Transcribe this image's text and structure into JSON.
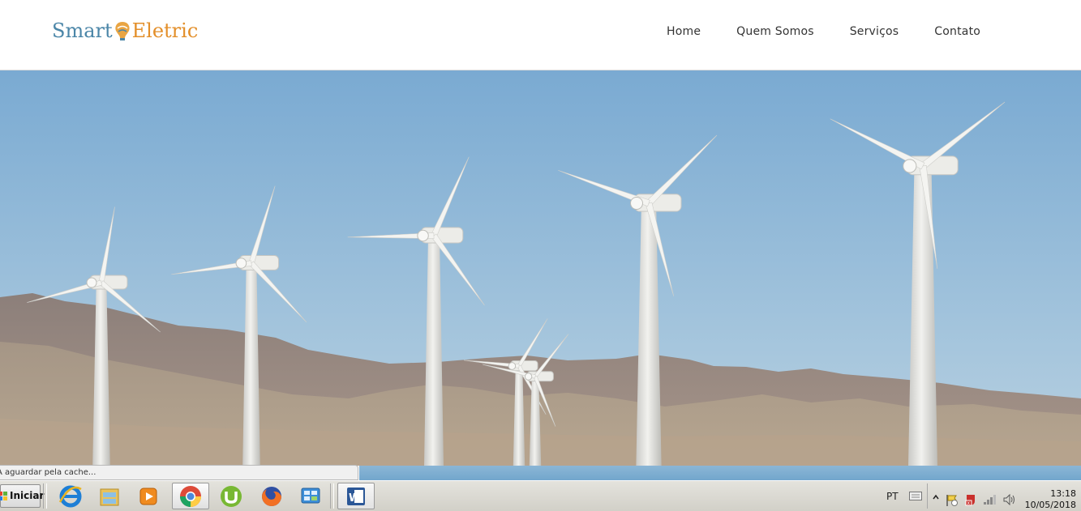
{
  "brand": {
    "part1": "Smart",
    "part2": "Eletric"
  },
  "nav": {
    "items": [
      "Home",
      "Quem Somos",
      "Serviços",
      "Contato"
    ]
  },
  "hero": {
    "image": "wind-turbines-over-mountains"
  },
  "browser_status": {
    "text": "A aguardar pela cache..."
  },
  "taskbar": {
    "start_label": "Iniciar",
    "apps": [
      "internet-explorer-icon",
      "file-explorer-icon",
      "media-player-icon",
      "chrome-icon",
      "utorrent-icon",
      "firefox-icon",
      "control-panel-icon",
      "word-icon"
    ],
    "language": "PT",
    "clock_time": "13:18",
    "clock_date": "10/05/2018"
  },
  "colors": {
    "brand_blue": "#4b86a8",
    "brand_orange": "#e38f2a",
    "sky": "#86b2d4"
  }
}
